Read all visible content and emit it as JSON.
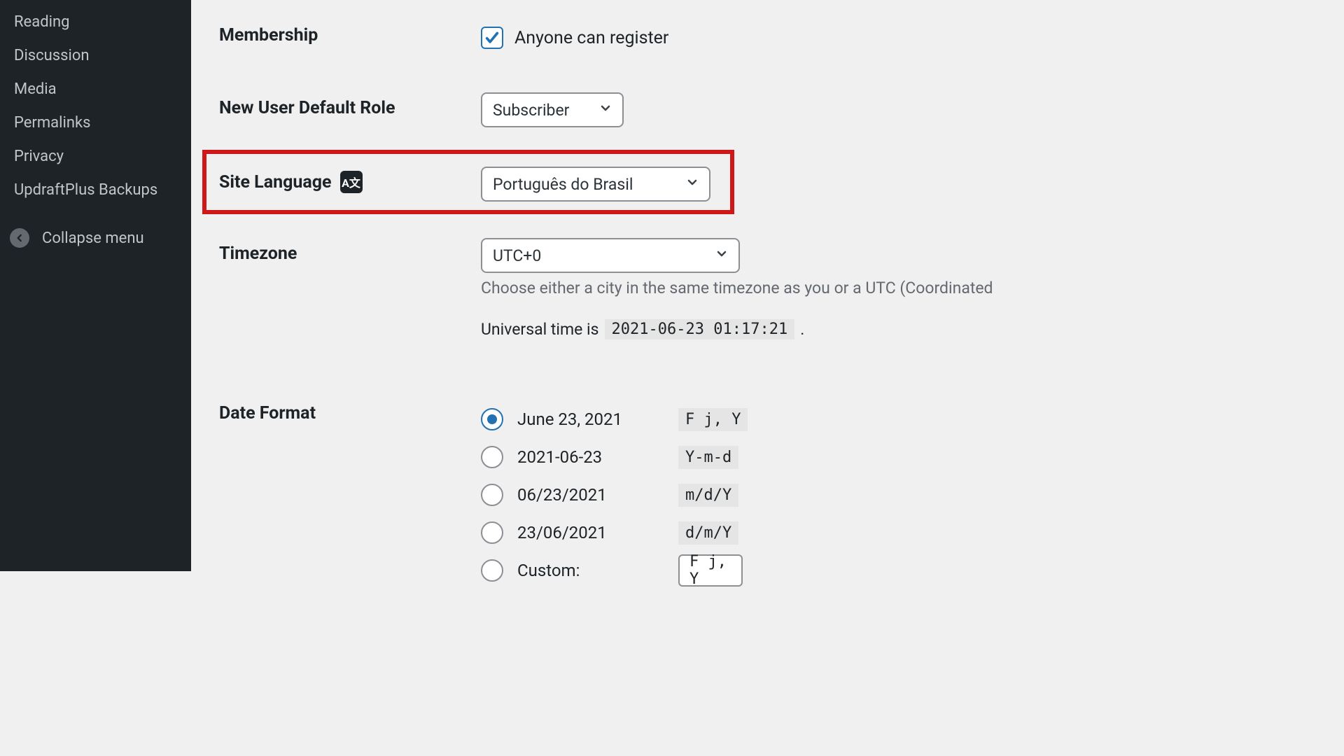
{
  "sidebar": {
    "items": [
      "Reading",
      "Discussion",
      "Media",
      "Permalinks",
      "Privacy",
      "UpdraftPlus Backups"
    ],
    "collapse_label": "Collapse menu"
  },
  "settings": {
    "membership": {
      "label": "Membership",
      "checkbox_label": "Anyone can register",
      "checked": true
    },
    "role": {
      "label": "New User Default Role",
      "value": "Subscriber"
    },
    "language": {
      "label": "Site Language",
      "value": "Português do Brasil"
    },
    "timezone": {
      "label": "Timezone",
      "value": "UTC+0",
      "description": "Choose either a city in the same timezone as you or a UTC (Coordinated",
      "universal_prefix": "Universal time is",
      "universal_value": "2021-06-23 01:17:21",
      "universal_suffix": "."
    },
    "date_format": {
      "label": "Date Format",
      "options": [
        {
          "display": "June 23, 2021",
          "code": "F j, Y",
          "checked": true
        },
        {
          "display": "2021-06-23",
          "code": "Y-m-d",
          "checked": false
        },
        {
          "display": "06/23/2021",
          "code": "m/d/Y",
          "checked": false
        },
        {
          "display": "23/06/2021",
          "code": "d/m/Y",
          "checked": false
        }
      ],
      "custom_label": "Custom:",
      "custom_value": "F j, Y"
    }
  }
}
